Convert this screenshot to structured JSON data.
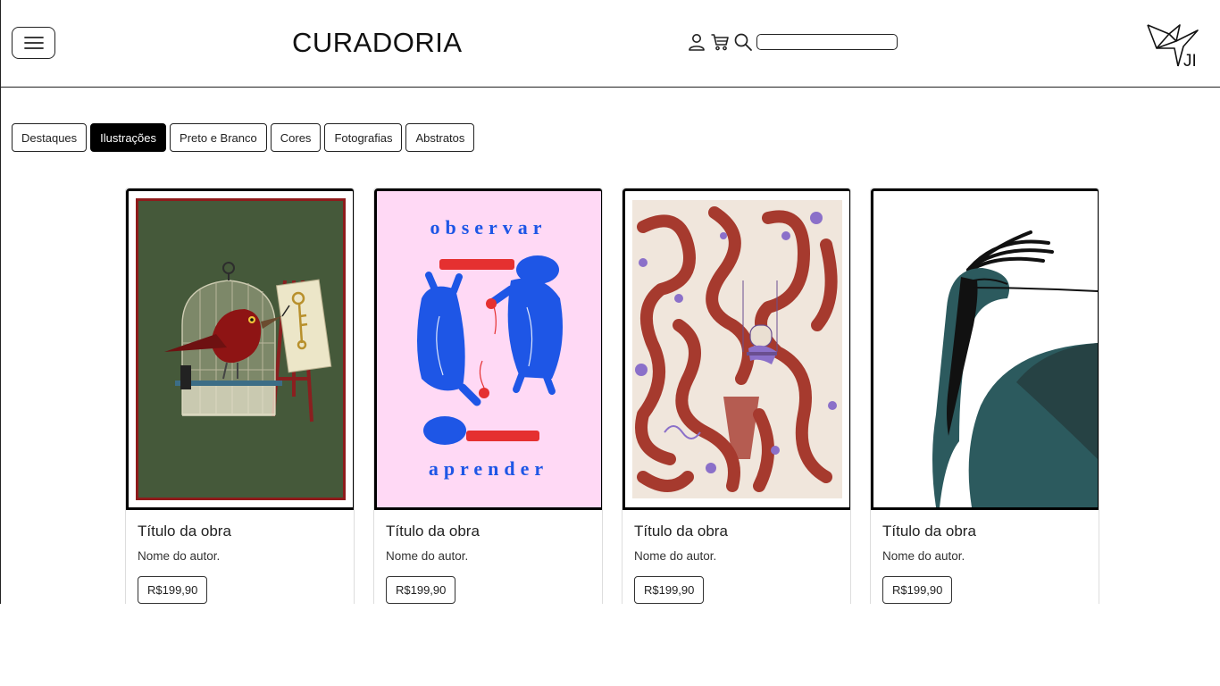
{
  "header": {
    "brand": "CURADORIA",
    "search_placeholder": "",
    "icons": [
      "user-icon",
      "cart-icon",
      "search-icon"
    ],
    "logo": "origami-bird-logo",
    "logo_text": "JI"
  },
  "tabs": [
    {
      "label": "Destaques",
      "active": false
    },
    {
      "label": "Ilustrações",
      "active": true
    },
    {
      "label": "Preto e Branco",
      "active": false
    },
    {
      "label": "Cores",
      "active": false
    },
    {
      "label": "Fotografias",
      "active": false
    },
    {
      "label": "Abstratos",
      "active": false
    }
  ],
  "cards": [
    {
      "title": "Título da obra",
      "author": "Nome do autor.",
      "price": "R$199,90"
    },
    {
      "title": "Título da obra",
      "author": "Nome do autor.",
      "price": "R$199,90",
      "art_top_text": "observar",
      "art_bottom_text": "aprender"
    },
    {
      "title": "Título da obra",
      "author": "Nome do autor.",
      "price": "R$199,90"
    },
    {
      "title": "Título da obra",
      "author": "Nome do autor.",
      "price": "R$199,90"
    }
  ],
  "colors": {
    "active_tab": "#000000",
    "border": "#222222",
    "card1_bg": "#45593a",
    "card1_frame": "#8e1b1b",
    "card2_bg": "#ffd9f5",
    "card2_blue": "#1e56e6",
    "card2_red": "#e53030",
    "card3_bg": "#f0e6dc",
    "card3_swirl": "#a63a2e",
    "card4_bird": "#2c5a5e"
  }
}
